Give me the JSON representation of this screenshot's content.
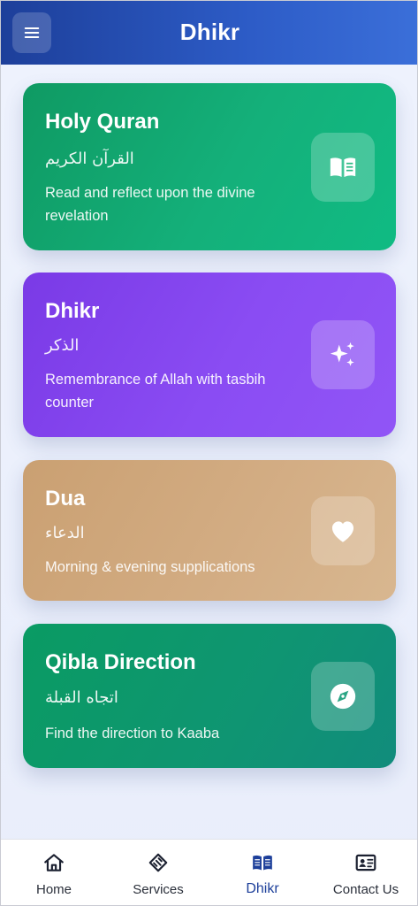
{
  "header": {
    "title": "Dhikr",
    "menu_icon": "hamburger-menu-icon"
  },
  "cards": [
    {
      "title": "Holy Quran",
      "arabic": "القرآن الكريم",
      "description": "Read and reflect upon the divine revelation",
      "icon": "book-open-icon",
      "color": "#13a872"
    },
    {
      "title": "Dhikr",
      "arabic": "الذكر",
      "description": "Remembrance of Allah with tasbih counter",
      "icon": "sparkles-icon",
      "color": "#8a4cf3"
    },
    {
      "title": "Dua",
      "arabic": "الدعاء",
      "description": "Morning & evening supplications",
      "icon": "heart-icon",
      "color": "#d1aa80"
    },
    {
      "title": "Qibla Direction",
      "arabic": "اتجاه القبلة",
      "description": "Find the direction to Kaaba",
      "icon": "compass-icon",
      "color": "#0f9570"
    }
  ],
  "bottom_nav": {
    "active_color": "#1d3f9a",
    "items": [
      {
        "label": "Home",
        "icon": "home-icon",
        "active": false
      },
      {
        "label": "Services",
        "icon": "handshake-icon",
        "active": false
      },
      {
        "label": "Dhikr",
        "icon": "book-icon",
        "active": true
      },
      {
        "label": "Contact Us",
        "icon": "contact-card-icon",
        "active": false
      }
    ]
  }
}
